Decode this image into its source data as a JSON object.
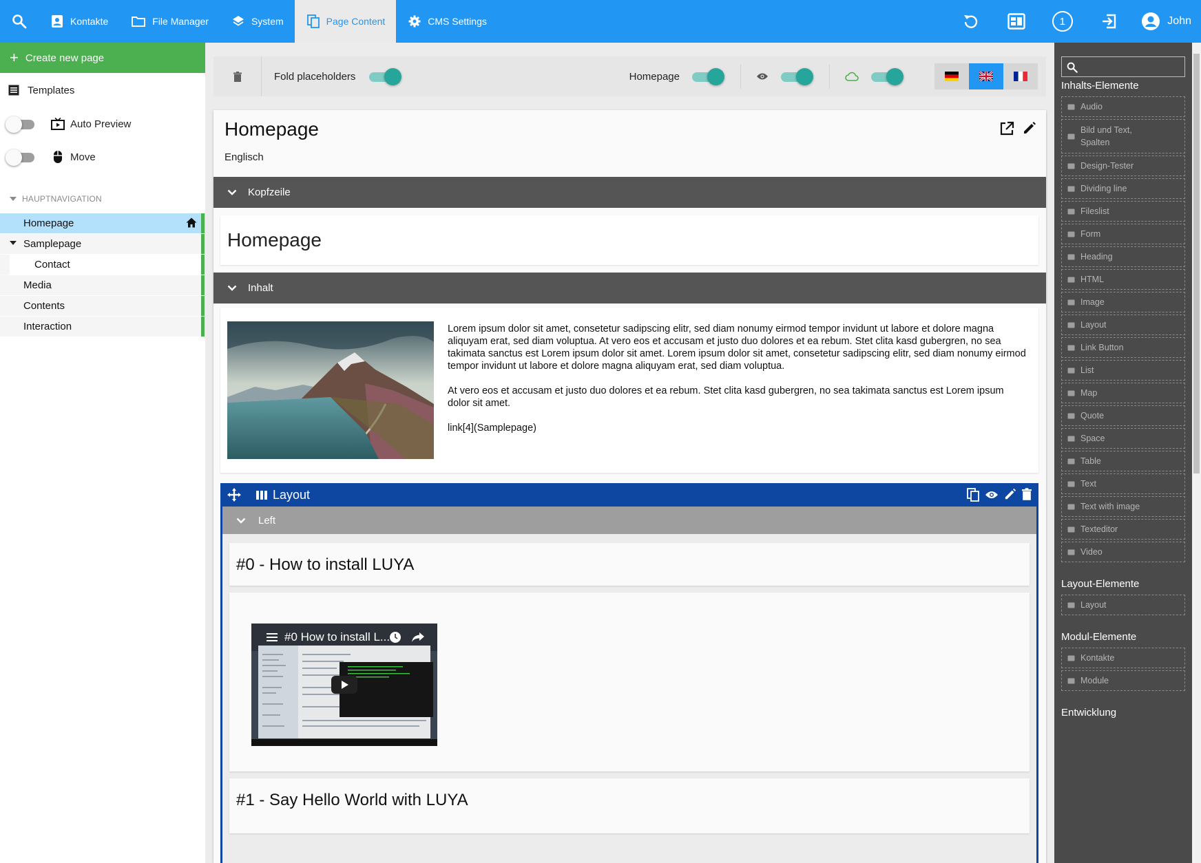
{
  "topnav": {
    "items": [
      {
        "label": "Kontakte",
        "icon": "contact-card-icon"
      },
      {
        "label": "File Manager",
        "icon": "folder-icon"
      },
      {
        "label": "System",
        "icon": "layers-icon"
      },
      {
        "label": "Page Content",
        "icon": "copy-pages-icon",
        "active": true
      },
      {
        "label": "CMS Settings",
        "icon": "gear-icon"
      }
    ],
    "notification_count": "1",
    "username": "John"
  },
  "sidebar": {
    "create_label": "Create new page",
    "templates_label": "Templates",
    "auto_preview_label": "Auto Preview",
    "move_label": "Move",
    "nav_header": "HAUPTNAVIGATION",
    "nav_items": [
      {
        "label": "Homepage"
      },
      {
        "label": "Samplepage"
      },
      {
        "label": "Contact"
      },
      {
        "label": "Media"
      },
      {
        "label": "Contents"
      },
      {
        "label": "Interaction"
      }
    ]
  },
  "toolbar": {
    "fold_label": "Fold placeholders",
    "homepage_label": "Homepage",
    "languages": [
      "de",
      "en",
      "fr"
    ],
    "active_language": "en"
  },
  "page": {
    "title": "Homepage",
    "language": "Englisch",
    "placeholders": {
      "header": "Kopfzeile",
      "content": "Inhalt"
    },
    "heading_block": "Homepage",
    "text_paragraphs": [
      "Lorem ipsum dolor sit amet, consetetur sadipscing elitr, sed diam nonumy eirmod tempor invidunt ut labore et dolore magna aliquyam erat, sed diam voluptua. At vero eos et accusam et justo duo dolores et ea rebum. Stet clita kasd gubergren, no sea takimata sanctus est Lorem ipsum dolor sit amet. Lorem ipsum dolor sit amet, consetetur sadipscing elitr, sed diam nonumy eirmod tempor invidunt ut labore et dolore magna aliquyam erat, sed diam voluptua.",
      "At vero eos et accusam et justo duo dolores et ea rebum. Stet clita kasd gubergren, no sea takimata sanctus est Lorem ipsum dolor sit amet.",
      "link[4](Samplepage)"
    ],
    "layout_block": {
      "label": "Layout",
      "column": "Left",
      "heading_0": "#0 - How to install LUYA",
      "video_title": "#0 How to install L...",
      "heading_1": "#1 - Say Hello World with LUYA"
    }
  },
  "blocks_panel": {
    "sections": [
      {
        "title": "Inhalts-Elemente",
        "items": [
          {
            "label": "Audio",
            "icon": "volume-icon"
          },
          {
            "label": "Bild und Text, Spalten",
            "icon": "comment-icon"
          },
          {
            "label": "Design-Tester",
            "icon": "design-icon"
          },
          {
            "label": "Dividing line",
            "icon": "dash-icon"
          },
          {
            "label": "Fileslist",
            "icon": "attachment-icon"
          },
          {
            "label": "Form",
            "icon": "mail-icon"
          },
          {
            "label": "Heading",
            "icon": "text-size-icon"
          },
          {
            "label": "HTML",
            "icon": "code-icon"
          },
          {
            "label": "Image",
            "icon": "crop-icon"
          },
          {
            "label": "Layout",
            "icon": "columns-icon"
          },
          {
            "label": "Link Button",
            "icon": "link-icon"
          },
          {
            "label": "List",
            "icon": "list-icon"
          },
          {
            "label": "Map",
            "icon": "map-icon"
          },
          {
            "label": "Quote",
            "icon": "quote-icon"
          },
          {
            "label": "Space",
            "icon": "spacing-icon"
          },
          {
            "label": "Table",
            "icon": "table-icon"
          },
          {
            "label": "Text",
            "icon": "text-lines-icon"
          },
          {
            "label": "Text with image",
            "icon": "text-image-icon"
          },
          {
            "label": "Texteditor",
            "icon": "text-format-icon"
          },
          {
            "label": "Video",
            "icon": "videocam-icon"
          }
        ]
      },
      {
        "title": "Layout-Elemente",
        "items": [
          {
            "label": "Layout",
            "icon": "layout-icon"
          }
        ]
      },
      {
        "title": "Modul-Elemente",
        "items": [
          {
            "label": "Kontakte",
            "icon": "contact-card-icon"
          },
          {
            "label": "Module",
            "icon": "apps-icon"
          }
        ]
      },
      {
        "title": "Entwicklung",
        "items": []
      }
    ]
  },
  "colors": {
    "topbar": "#2196f3",
    "create_button": "#4caf50",
    "toggle_on": "#26a69a",
    "placeholder_bar": "#555555",
    "layout_border": "#0d47a1",
    "right_panel": "#4a4a4a"
  }
}
